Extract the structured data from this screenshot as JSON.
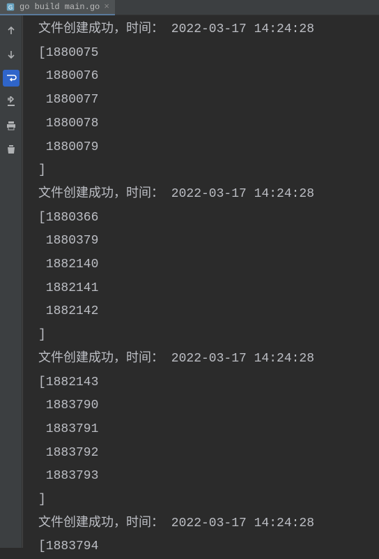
{
  "tab": {
    "label": "go build main.go"
  },
  "console_lines": [
    "文件创建成功，时间： 2022-03-17 14:24:28",
    "[1880075",
    " 1880076",
    " 1880077",
    " 1880078",
    " 1880079",
    "]",
    "文件创建成功，时间： 2022-03-17 14:24:28",
    "[1880366",
    " 1880379",
    " 1882140",
    " 1882141",
    " 1882142",
    "]",
    "文件创建成功，时间： 2022-03-17 14:24:28",
    "[1882143",
    " 1883790",
    " 1883791",
    " 1883792",
    " 1883793",
    "]",
    "文件创建成功，时间： 2022-03-17 14:24:28",
    "[1883794"
  ]
}
